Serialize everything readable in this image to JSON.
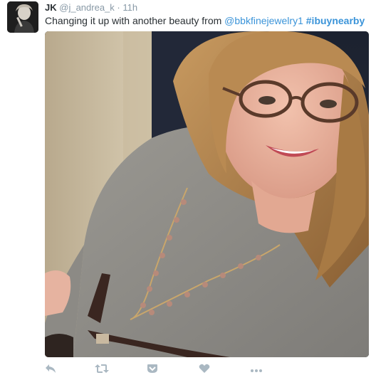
{
  "tweet": {
    "author_name": "JK",
    "author_handle": "@j_andrea_k",
    "separator": "·",
    "timestamp": "11h",
    "text_prefix": "Changing it up with another beauty from ",
    "mention": "@bbkfinejewelry1",
    "hashtag": "#ibuynearby"
  },
  "actions": [
    {
      "name": "reply-icon"
    },
    {
      "name": "retweet-icon"
    },
    {
      "name": "save-icon"
    },
    {
      "name": "like-icon"
    },
    {
      "name": "more-icon"
    }
  ],
  "colors": {
    "link": "#3b94d9",
    "muted": "#8899a6",
    "text": "#292f33",
    "icon": "#aab8c2"
  }
}
